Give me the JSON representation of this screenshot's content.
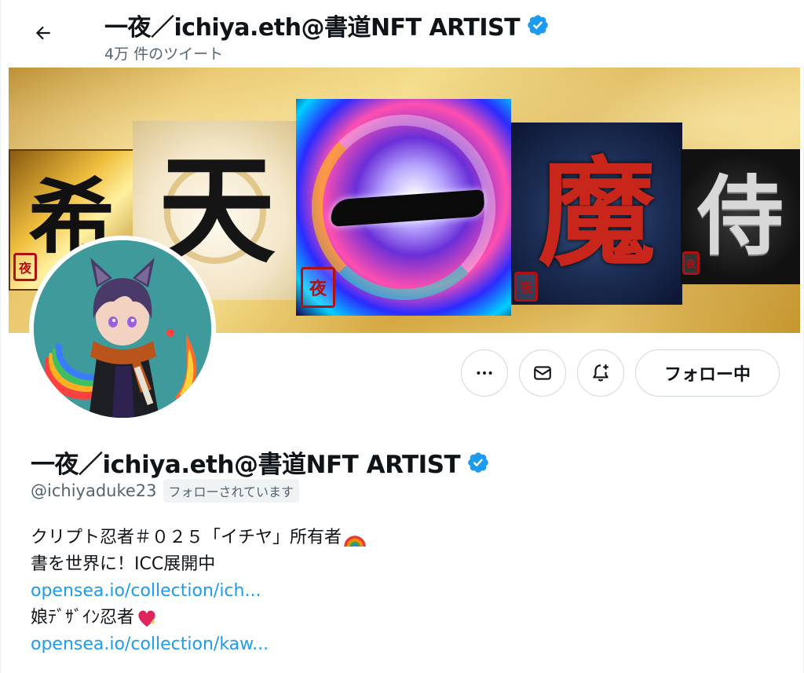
{
  "header": {
    "title": "一夜／ichiya.eth@書道NFT ARTIST",
    "tweet_count": "4万 件のツイート"
  },
  "banner": {
    "tiles": [
      {
        "kanji": "希"
      },
      {
        "kanji": "天"
      },
      {
        "kanji": "一"
      },
      {
        "kanji": "魔"
      },
      {
        "kanji": "侍"
      }
    ],
    "seal_char": "夜"
  },
  "actions": {
    "follow_label": "フォロー中"
  },
  "profile": {
    "display_name": "一夜／ichiya.eth@書道NFT ARTIST",
    "handle": "@ichiyaduke23",
    "follows_you": "フォローされています",
    "bio": {
      "line1": "クリプト忍者＃０２５「イチヤ」所有者",
      "line2": "書を世界に！ICC展開中",
      "link1": "opensea.io/collection/ich...",
      "line3": "娘ﾃﾞｻﾞｲﾝ忍者",
      "link2": "opensea.io/collection/kaw..."
    }
  },
  "colors": {
    "verified": "#1d9bf0",
    "link": "#1d9bf0",
    "secondary_text": "#536471",
    "border": "#cfd9de"
  }
}
